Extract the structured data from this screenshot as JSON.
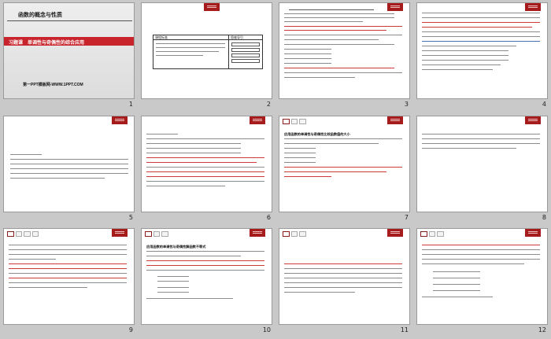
{
  "slides": [
    {
      "num": "1",
      "title": "函数的概念与性质",
      "subtitle": "习题课　单调性与奇偶性的综合应用",
      "footer": "第一PPT模板网-WWW.1PPT.COM"
    },
    {
      "num": "2",
      "header": "课程标准",
      "header2": "思维导引"
    },
    {
      "num": "3"
    },
    {
      "num": "4"
    },
    {
      "num": "5"
    },
    {
      "num": "6"
    },
    {
      "num": "7",
      "title": "应用函数的单调性与奇偶性比较函数值的大小"
    },
    {
      "num": "8"
    },
    {
      "num": "9"
    },
    {
      "num": "10",
      "title": "应用函数的单调性与奇偶性解函数不等式"
    },
    {
      "num": "11"
    },
    {
      "num": "12"
    }
  ],
  "colors": {
    "accent_red": "#c8242b",
    "slide_bg": "#ffffff",
    "canvas_bg": "#c9c9c9"
  }
}
